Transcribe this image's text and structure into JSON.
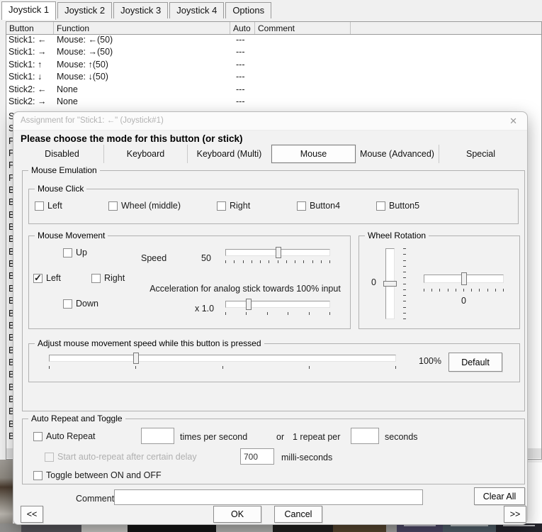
{
  "desktop": {
    "thumbnails": [
      {
        "color": "#8f8e8c",
        "w": 30
      },
      {
        "color": "#55545a",
        "w": 85
      },
      {
        "color": "#c8c7c4",
        "w": 65
      },
      {
        "color": "#161616",
        "w": 125
      },
      {
        "color": "#b3b3b0",
        "w": 80
      },
      {
        "color": "#211f1e",
        "w": 85
      },
      {
        "color": "#55452f",
        "w": 75
      },
      {
        "color": "#a3a3a1",
        "w": 15
      },
      {
        "color": "#4c4766",
        "w": 65,
        "bar": true
      },
      {
        "color": "#4f5e68",
        "w": 75,
        "bar": true
      },
      {
        "color": "#23232b",
        "w": 65,
        "bar": true
      }
    ]
  },
  "app": {
    "tabs": [
      {
        "label": "Joystick 1"
      },
      {
        "label": "Joystick 2"
      },
      {
        "label": "Joystick 3"
      },
      {
        "label": "Joystick 4"
      },
      {
        "label": "Options"
      }
    ],
    "table": {
      "columns": {
        "button": "Button",
        "function": "Function",
        "auto": "Auto",
        "comment": "Comment"
      },
      "rows": [
        {
          "button": "Stick1: ←",
          "func": "Mouse: ←(50)",
          "auto": "---"
        },
        {
          "button": "Stick1: →",
          "func": "Mouse: →(50)",
          "auto": "---"
        },
        {
          "button": "Stick1: ↑",
          "func": "Mouse: ↑(50)",
          "auto": "---"
        },
        {
          "button": "Stick1: ↓",
          "func": "Mouse: ↓(50)",
          "auto": "---"
        },
        {
          "button": "Stick2: ←",
          "func": "None",
          "auto": "---"
        },
        {
          "button": "Stick2: →",
          "func": "None",
          "auto": "---"
        }
      ],
      "partial_rows": [
        "S",
        "S",
        "P",
        "P",
        "P",
        "P",
        "B",
        "B",
        "B",
        "B",
        "B",
        "B",
        "B",
        "B",
        "B",
        "B",
        "B",
        "B",
        "B",
        "B",
        "B",
        "B",
        "B",
        "B",
        "B",
        "B",
        "B"
      ]
    }
  },
  "dialog": {
    "title": "Assignment for \"Stick1: ←\" (Joystick#1)",
    "close_icon": "✕",
    "heading": "Please choose the mode for this button (or stick)",
    "mode_tabs": [
      "Disabled",
      "Keyboard",
      "Keyboard (Multi)",
      "Mouse",
      "Mouse (Advanced)",
      "Special"
    ],
    "selected_mode": "Mouse",
    "mouse_emulation": {
      "title": "Mouse Emulation",
      "mouse_click": {
        "title": "Mouse Click",
        "checkboxes": [
          {
            "label": "Left",
            "checked": false
          },
          {
            "label": "Wheel (middle)",
            "checked": false
          },
          {
            "label": "Right",
            "checked": false
          },
          {
            "label": "Button4",
            "checked": false
          },
          {
            "label": "Button5",
            "checked": false
          }
        ]
      },
      "mouse_movement": {
        "title": "Mouse Movement",
        "up": {
          "label": "Up",
          "checked": false
        },
        "left": {
          "label": "Left",
          "checked": true
        },
        "right": {
          "label": "Right",
          "checked": false
        },
        "down": {
          "label": "Down",
          "checked": false
        },
        "speed": {
          "label": "Speed",
          "value": "50",
          "thumb_pct": 51,
          "ticks": 13
        },
        "acceleration": {
          "label": "Acceleration for analog stick towards 100% input",
          "value": "x 1.0",
          "thumb_pct": 22,
          "ticks": 6
        }
      },
      "wheel_rotation": {
        "title": "Wheel Rotation",
        "vertical": {
          "value": "0",
          "thumb_pct": 50,
          "ticks": 13
        },
        "horizontal": {
          "value": "0",
          "thumb_pct": 50,
          "ticks": 11
        }
      },
      "adjust_speed": {
        "title": "Adjust mouse movement speed while this button is pressed",
        "value": "100%",
        "thumb_pct": 25,
        "ticks": 5,
        "default_label": "Default"
      }
    },
    "auto_repeat": {
      "title": "Auto Repeat and Toggle",
      "auto_repeat_label": "Auto Repeat",
      "times_value": "",
      "times_label": "times per second",
      "or_label": "or",
      "repeat_per_label": "1 repeat per",
      "seconds_value": "",
      "seconds_label": "seconds",
      "delay_label": "Start auto-repeat after certain delay",
      "delay_checked": false,
      "delay_value": "700",
      "delay_unit": "milli-seconds",
      "toggle_label": "Toggle between ON and OFF"
    },
    "footer": {
      "comment_label": "Comment:",
      "comment_value": "",
      "clear_all_label": "Clear All",
      "ok_label": "OK",
      "cancel_label": "Cancel",
      "prev_label": "<<",
      "next_label": ">>"
    }
  }
}
